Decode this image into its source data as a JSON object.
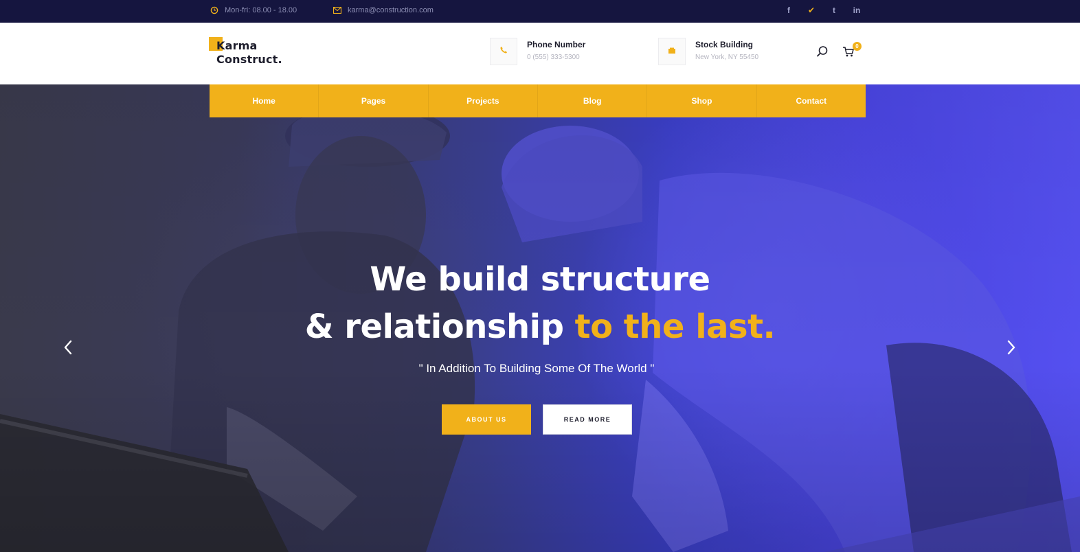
{
  "topbar": {
    "hours_icon": "clock-icon",
    "hours": "Mon-fri: 08.00 - 18.00",
    "email_icon": "mail-icon",
    "email": "karma@construction.com",
    "socials": [
      {
        "label": "f",
        "icon": "facebook-icon"
      },
      {
        "label": "✔",
        "icon": "twitter-icon"
      },
      {
        "label": "t",
        "icon": "tumblr-icon"
      },
      {
        "label": "in",
        "icon": "linkedin-icon"
      }
    ]
  },
  "header": {
    "logo_line1": "Karma",
    "logo_line2": "Construct.",
    "phone_title": "Phone Number",
    "phone_value": "0 (555) 333-5300",
    "location_title": "Stock Building",
    "location_value": "New York, NY 55450",
    "cart_count": "0"
  },
  "nav": {
    "items": [
      "Home",
      "Pages",
      "Projects",
      "Blog",
      "Shop",
      "Contact"
    ]
  },
  "hero": {
    "headline_line1": "We build structure",
    "headline_line2_part1": "& relationship ",
    "headline_line2_accent": "to the last.",
    "subtitle": "\" In Addition To Building Some Of The World \"",
    "primary_button": "ABOUT US",
    "secondary_button": "READ MORE"
  },
  "colors": {
    "accent": "#f1b11a",
    "topbar_bg": "#15153f",
    "hero_overlay": "#4a45e2",
    "text_dark": "#1d1d2c"
  }
}
